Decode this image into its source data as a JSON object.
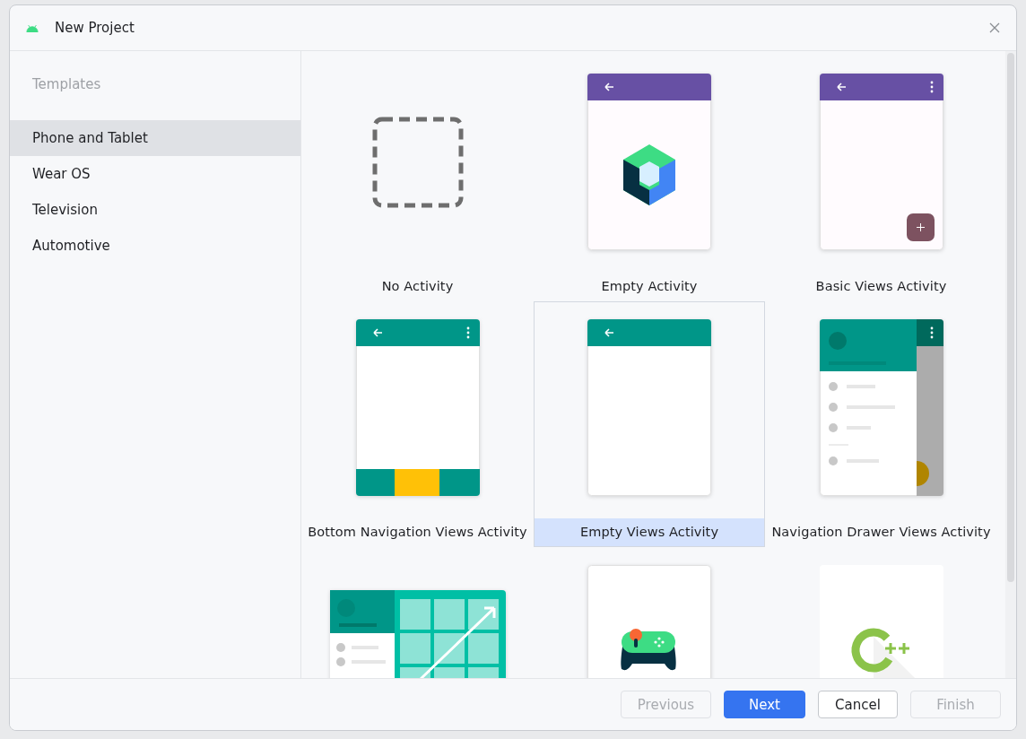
{
  "window": {
    "title": "New Project"
  },
  "sidebar": {
    "heading": "Templates",
    "items": [
      {
        "label": "Phone and Tablet",
        "selected": true
      },
      {
        "label": "Wear OS",
        "selected": false
      },
      {
        "label": "Television",
        "selected": false
      },
      {
        "label": "Automotive",
        "selected": false
      }
    ]
  },
  "templates": [
    {
      "kind": "none",
      "label": "No Activity",
      "selected": false
    },
    {
      "kind": "compose",
      "label": "Empty Activity",
      "selected": false
    },
    {
      "kind": "basic",
      "label": "Basic Views Activity",
      "selected": false
    },
    {
      "kind": "bottom-nav",
      "label": "Bottom Navigation Views Activity",
      "selected": false
    },
    {
      "kind": "empty-views",
      "label": "Empty Views Activity",
      "selected": true
    },
    {
      "kind": "nav-drawer",
      "label": "Navigation Drawer Views Activity",
      "selected": false
    },
    {
      "kind": "responsive",
      "selected": false
    },
    {
      "kind": "game",
      "selected": false
    },
    {
      "kind": "cpp",
      "selected": false
    }
  ],
  "buttons": [
    {
      "label": "Previous",
      "kind": "secondary",
      "disabled": true
    },
    {
      "label": "Next",
      "kind": "primary",
      "disabled": false
    },
    {
      "label": "Cancel",
      "kind": "secondary",
      "disabled": false
    },
    {
      "label": "Finish",
      "kind": "secondary",
      "disabled": true
    }
  ]
}
